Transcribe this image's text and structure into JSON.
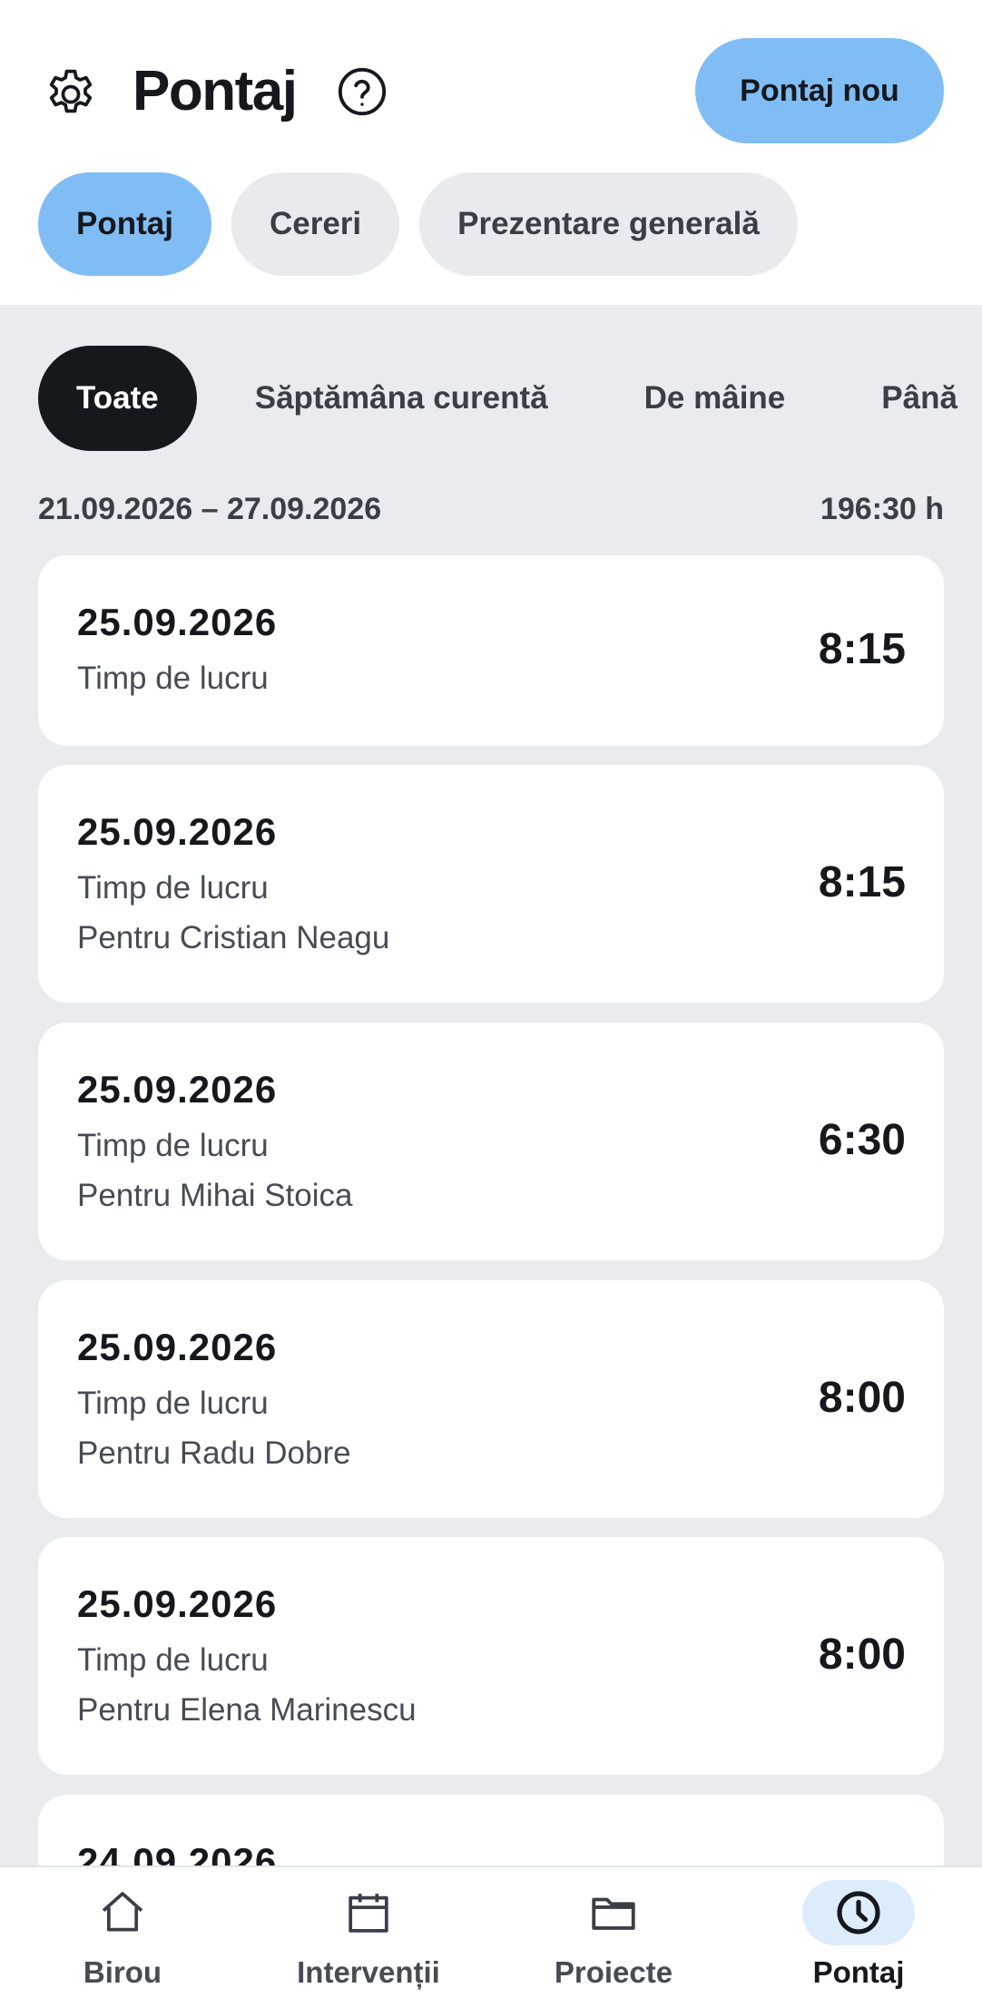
{
  "header": {
    "title": "Pontaj",
    "new_button": "Pontaj nou",
    "settings_icon": "gear-icon",
    "help_icon": "question-circle-icon"
  },
  "tabs": [
    {
      "label": "Pontaj",
      "active": true
    },
    {
      "label": "Cereri",
      "active": false
    },
    {
      "label": "Prezentare generală",
      "active": false
    }
  ],
  "filters": [
    {
      "label": "Toate",
      "active": true
    },
    {
      "label": "Săptămâna curentă",
      "active": false
    },
    {
      "label": "De mâine",
      "active": false
    },
    {
      "label": "Până",
      "active": false
    }
  ],
  "week": {
    "range": "21.09.2026 – 27.09.2026",
    "total": "196:30 h"
  },
  "entries": [
    {
      "date": "25.09.2026",
      "type": "Timp de lucru",
      "person": "",
      "hours": "8:15"
    },
    {
      "date": "25.09.2026",
      "type": "Timp de lucru",
      "person": "Pentru Cristian Neagu",
      "hours": "8:15"
    },
    {
      "date": "25.09.2026",
      "type": "Timp de lucru",
      "person": "Pentru Mihai Stoica",
      "hours": "6:30"
    },
    {
      "date": "25.09.2026",
      "type": "Timp de lucru",
      "person": "Pentru Radu Dobre",
      "hours": "8:00"
    },
    {
      "date": "25.09.2026",
      "type": "Timp de lucru",
      "person": "Pentru Elena Marinescu",
      "hours": "8:00"
    },
    {
      "date": "24.09.2026",
      "type": "",
      "person": "",
      "hours": ""
    }
  ],
  "nav": [
    {
      "label": "Birou",
      "icon": "home-icon",
      "active": false
    },
    {
      "label": "Intervenții",
      "icon": "calendar-icon",
      "active": false
    },
    {
      "label": "Proiecte",
      "icon": "folder-icon",
      "active": false
    },
    {
      "label": "Pontaj",
      "icon": "clock-icon",
      "active": true
    }
  ],
  "colors": {
    "accent": "#80bdf4",
    "dark": "#15181d",
    "background": "#e9ebee",
    "nav_active_bg": "#ddecfb"
  }
}
